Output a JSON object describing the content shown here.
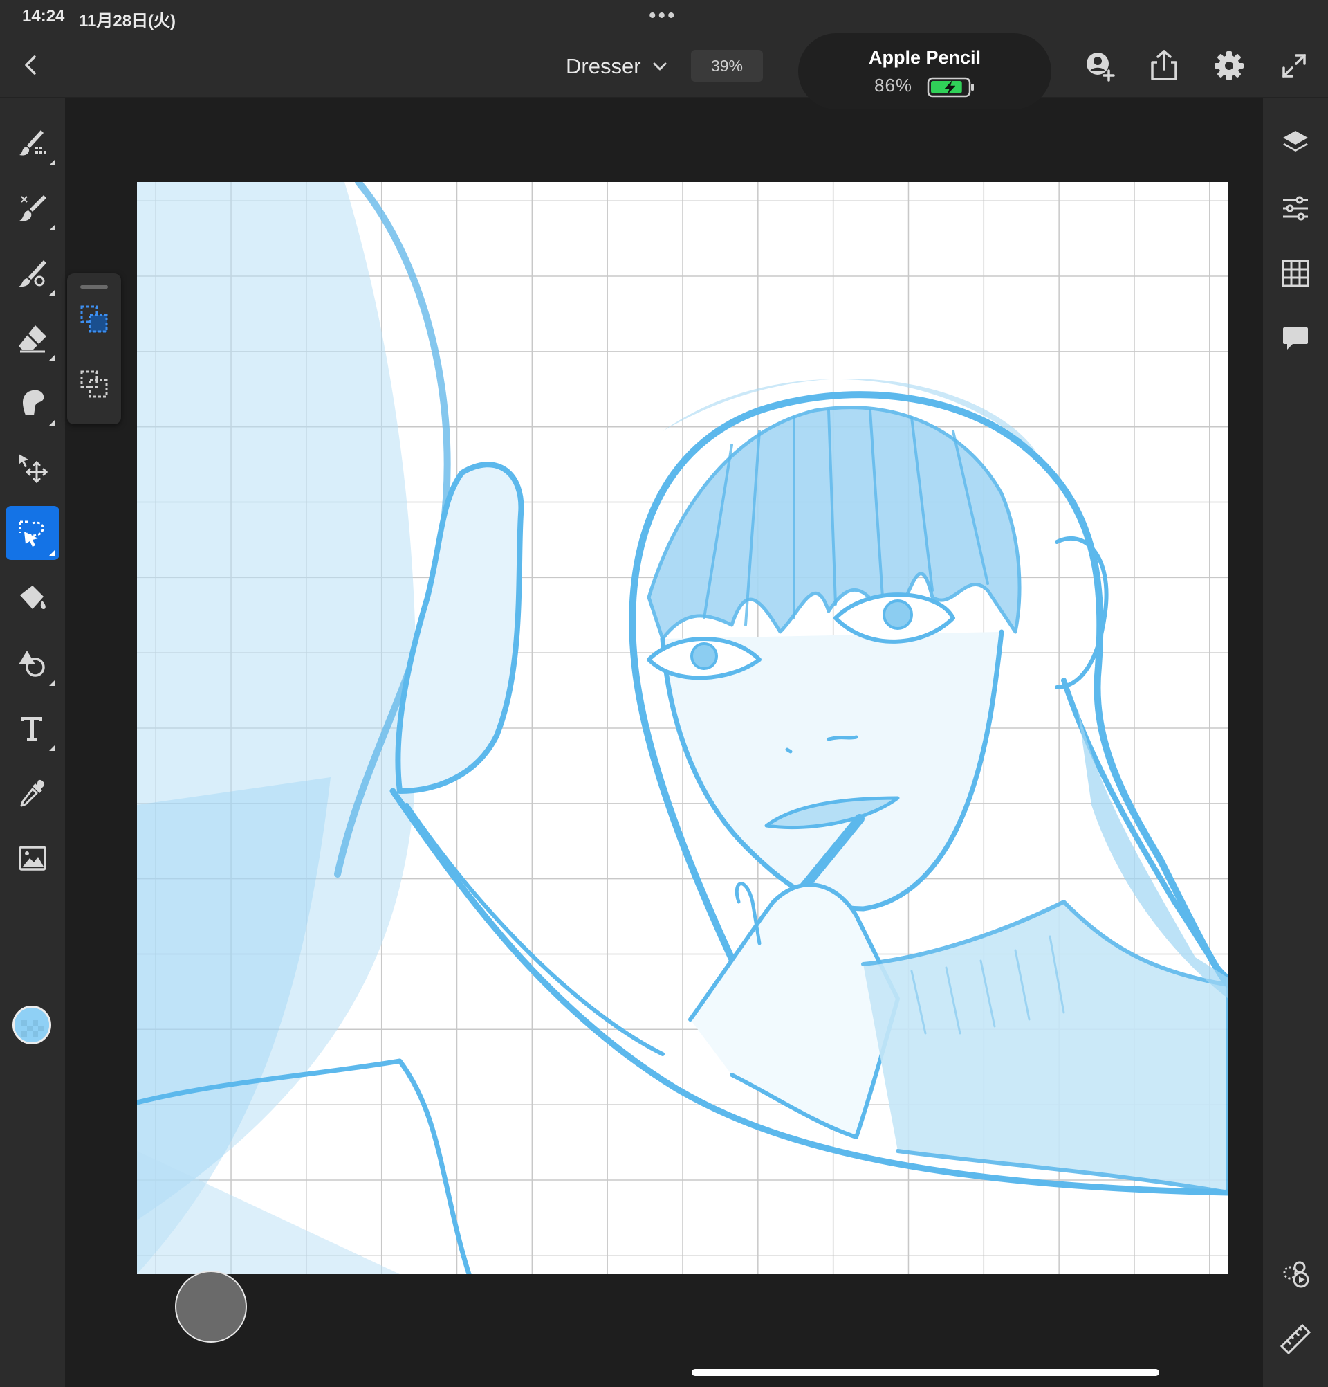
{
  "status_bar": {
    "time": "14:24",
    "date": "11月28日(火)",
    "multitask_dots": "•••"
  },
  "header": {
    "document_title": "Dresser",
    "zoom_level": "39%",
    "apple_pencil": {
      "title": "Apple Pencil",
      "battery_percent": "86%",
      "battery_level": 0.86,
      "charging": true,
      "battery_color": "#30d158"
    }
  },
  "top_icons": [
    "invite-user-icon",
    "share-icon",
    "settings-gear-icon",
    "fullscreen-expand-icon"
  ],
  "left_toolbar": {
    "tools": [
      "pixel-brush-icon",
      "live-brush-icon",
      "vector-brush-icon",
      "eraser-icon",
      "smudge-icon",
      "move-transform-icon",
      "selection-lasso-icon",
      "fill-bucket-icon",
      "shapes-icon",
      "text-icon",
      "eyedropper-icon",
      "image-import-icon"
    ],
    "active_tool": "selection-lasso-icon",
    "current_color": "#8fd0f5",
    "accent_color": "#1473e6"
  },
  "selection_popover": {
    "options": [
      "add-to-selection-icon",
      "subtract-from-selection-icon"
    ],
    "active_option": "add-to-selection-icon"
  },
  "right_toolbar": {
    "top_items": [
      "layers-icon",
      "adjustments-sliders-icon",
      "grid-icon",
      "comments-icon"
    ],
    "bottom_items": [
      "timelapse-replay-icon",
      "ruler-icon"
    ]
  },
  "canvas": {
    "background": "#ffffff",
    "grid_color": "#c8c8c8",
    "sketch_color": "#5cb8ec",
    "grid_divisions": 14.5
  }
}
